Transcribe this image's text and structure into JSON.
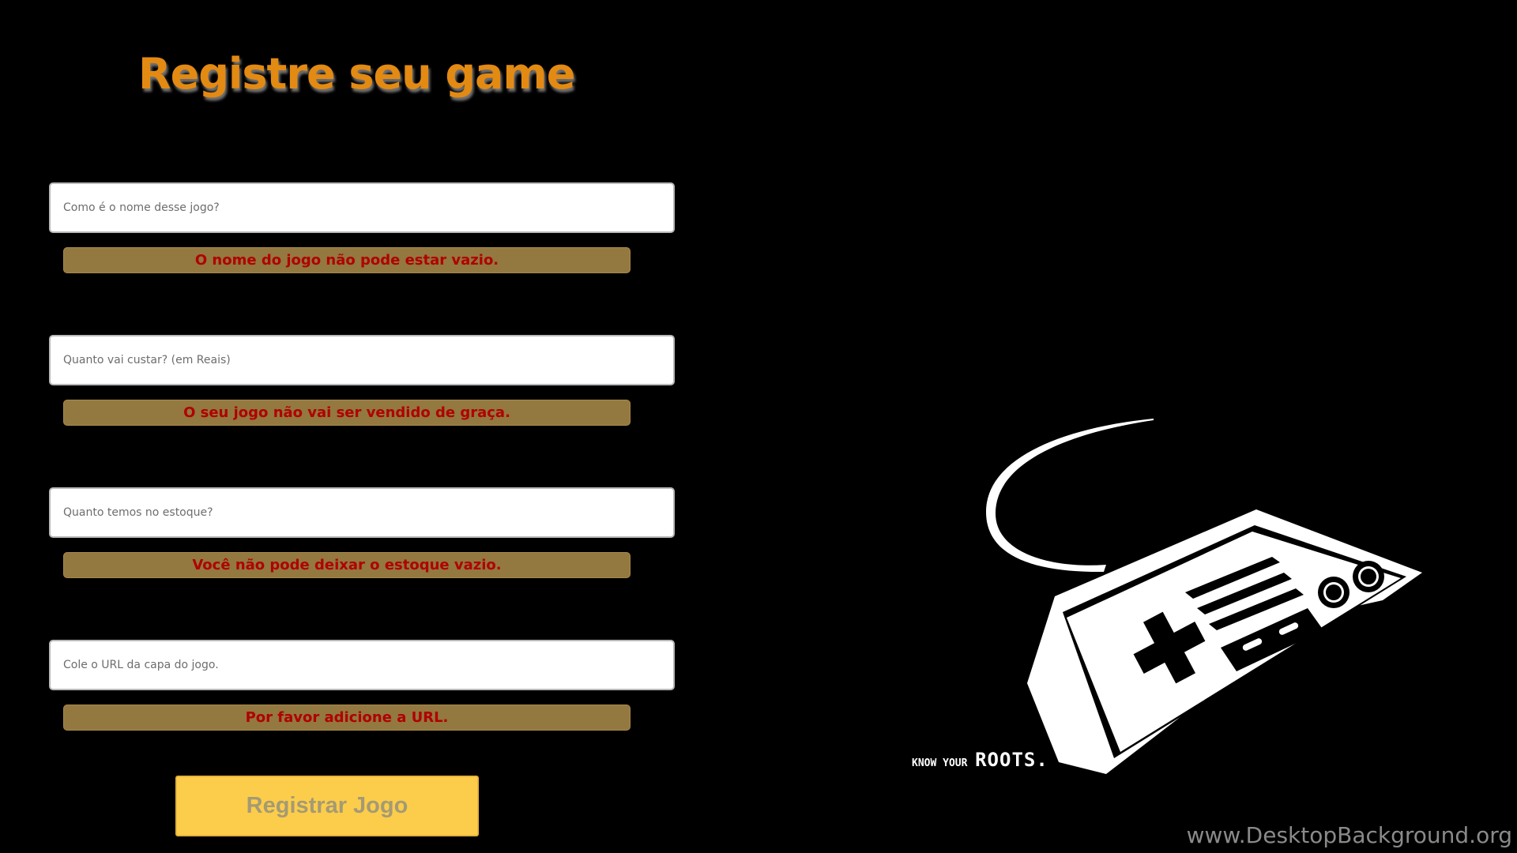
{
  "form": {
    "title": "Registre seu game",
    "fields": [
      {
        "placeholder": "Como é o nome desse jogo?",
        "value": "",
        "error": "O nome do jogo não pode estar vazio."
      },
      {
        "placeholder": "Quanto vai custar? (em Reais)",
        "value": "",
        "error": "O seu jogo não vai ser vendido de graça."
      },
      {
        "placeholder": "Quanto temos no estoque?",
        "value": "",
        "error": "Você não pode deixar o estoque vazio."
      },
      {
        "placeholder": "Cole o URL da capa do jogo.",
        "value": "",
        "error": "Por favor adicione a URL."
      }
    ],
    "submit_label": "Registrar Jogo"
  },
  "background": {
    "image_icon": "nes-controller-icon",
    "slogan_small": "KNOW YOUR",
    "slogan_big": "ROOTS.",
    "watermark": "www.DesktopBackground.org"
  },
  "colors": {
    "background": "#000000",
    "title": "#e38a13",
    "error_bg": "#937840",
    "error_text": "#b00000",
    "button_bg": "#fccd4b",
    "button_text": "#a49a74"
  }
}
